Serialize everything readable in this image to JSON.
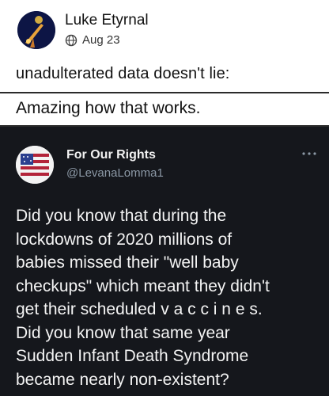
{
  "post": {
    "author_name": "Luke Etyrnal",
    "date": "Aug 23",
    "visibility_icon": "globe-icon",
    "caption": "unadulterated data doesn't lie:"
  },
  "shared_image": {
    "quote_text": "Amazing how that works.",
    "tweet": {
      "display_name": "For Our Rights",
      "handle": "@LevanaLomma1",
      "more_icon": "more-options-icon",
      "body": "Did you know that during the\nlockdowns of 2020 millions of\nbabies missed their \"well baby\ncheckups\" which meant they didn't\nget their scheduled v a c c i n e s.\nDid you know that same year\nSudden Infant Death Syndrome\nbecame nearly non-existent?"
    }
  },
  "colors": {
    "tweet_background": "#15171c",
    "tweet_text": "#f4f4f4",
    "handle_text": "#8b98a5"
  }
}
